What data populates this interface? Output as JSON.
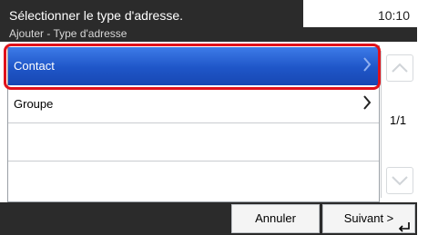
{
  "header": {
    "title": "Sélectionner le type d'adresse.",
    "time": "10:10",
    "subtitle": "Ajouter - Type d'adresse"
  },
  "list": {
    "items": [
      {
        "label": "Contact",
        "selected": true,
        "icon": "chevron-right-icon"
      },
      {
        "label": "Groupe",
        "selected": false,
        "icon": "chevron-right-icon"
      },
      {
        "label": "",
        "selected": false
      },
      {
        "label": "",
        "selected": false
      }
    ],
    "page_indicator": "1/1"
  },
  "footer": {
    "cancel_label": "Annuler",
    "next_label": "Suivant >"
  },
  "colors": {
    "selected_row": "#2a62d6",
    "highlight_ring": "#e0121a",
    "bar_background": "#2b2b2b"
  }
}
